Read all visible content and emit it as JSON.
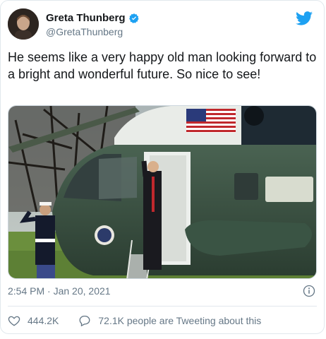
{
  "tweet": {
    "author_name": "Greta Thunberg",
    "author_handle": "@GretaThunberg",
    "text": "He seems like a very happy old man looking forward to a bright and wonderful future. So nice to see!",
    "time": "2:54 PM",
    "separator": "·",
    "date": "Jan 20, 2021",
    "likes": "444.2K",
    "conversation": "72.1K people are Tweeting about this"
  },
  "colors": {
    "brand_blue": "#1da1f2",
    "text_primary": "#14171a",
    "text_secondary": "#657786",
    "border": "#e1e8ed"
  },
  "icons": {
    "logo": "twitter-bird-icon",
    "verified": "verified-badge-icon",
    "info": "info-icon",
    "like": "heart-icon",
    "reply": "reply-bubble-icon"
  }
}
